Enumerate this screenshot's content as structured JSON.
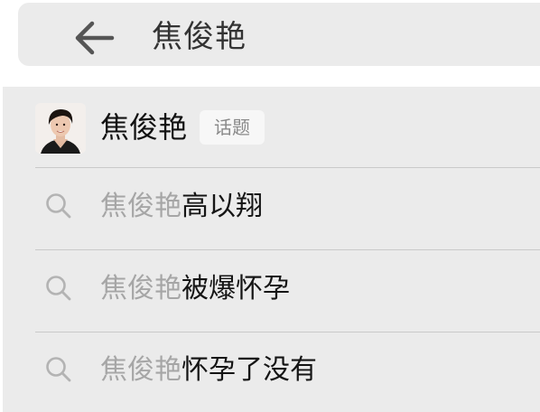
{
  "header": {
    "query": "焦俊艳",
    "back_icon": "arrow-left-icon"
  },
  "suggestions": {
    "topic": {
      "name": "焦俊艳",
      "badge": "话题",
      "avatar_icon": "person-avatar"
    },
    "items": [
      {
        "prefix": "焦俊艳",
        "suffix": "高以翔",
        "icon": "search-icon"
      },
      {
        "prefix": "焦俊艳",
        "suffix": "被爆怀孕",
        "icon": "search-icon"
      },
      {
        "prefix": "焦俊艳",
        "suffix": "怀孕了没有",
        "icon": "search-icon"
      }
    ]
  },
  "colors": {
    "background": "#ebebeb",
    "prefix_gray": "#a6a6a6",
    "text_dark": "#151515",
    "divider": "#c9c9c9"
  }
}
